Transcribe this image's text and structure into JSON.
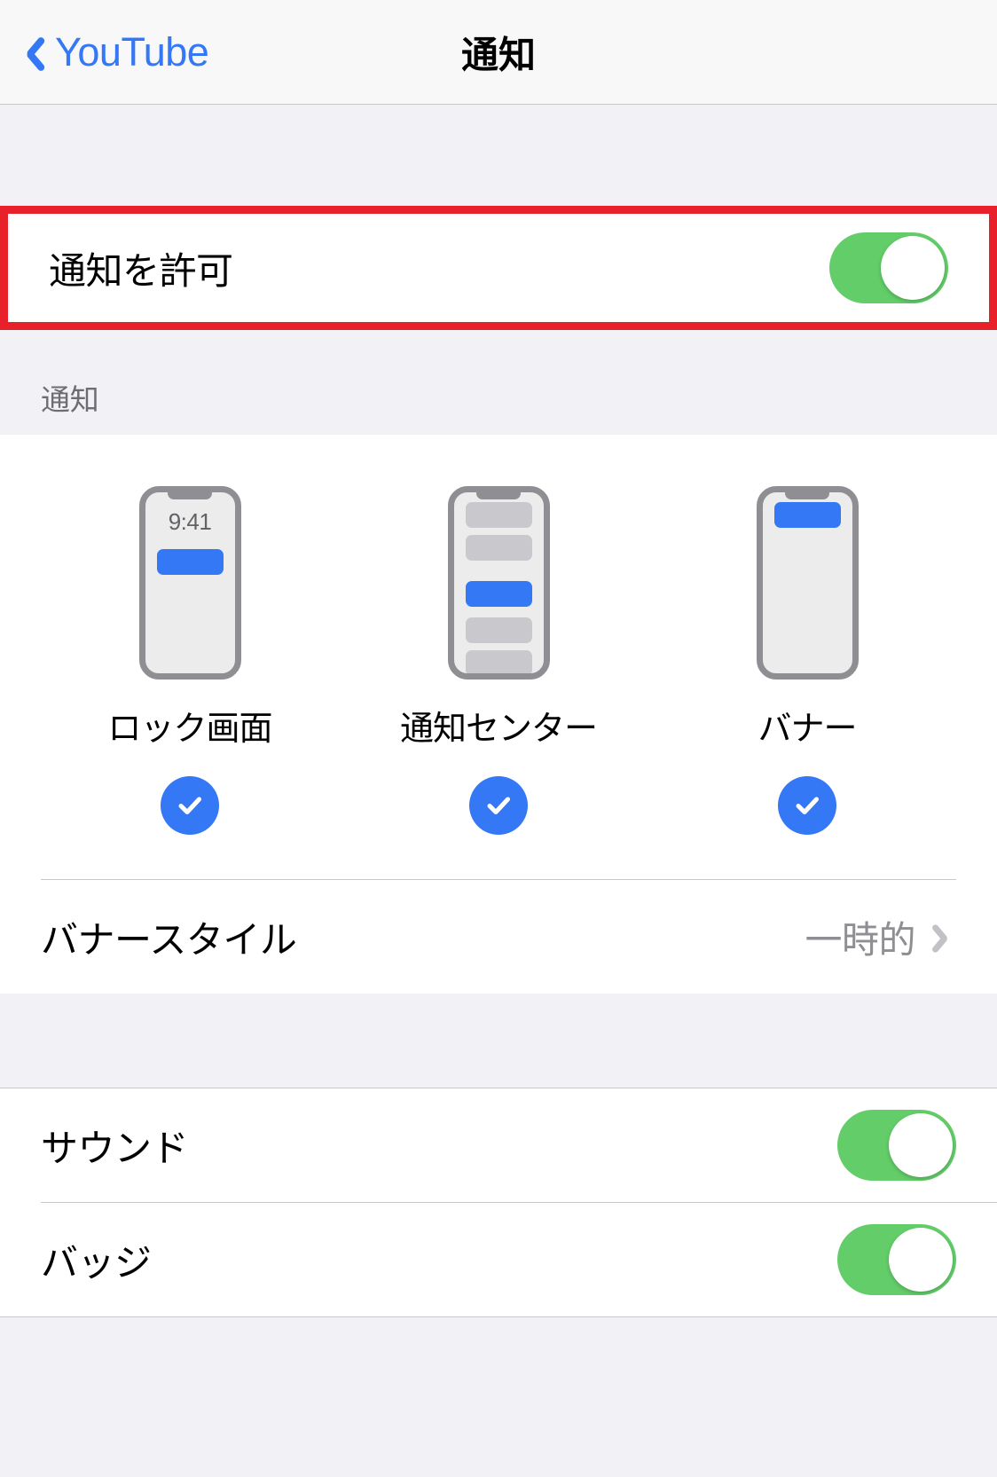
{
  "nav": {
    "back_label": "YouTube",
    "title": "通知"
  },
  "allow_notifications": {
    "label": "通知を許可",
    "toggle_state": "on",
    "highlight_color": "#e8202a"
  },
  "alerts_section": {
    "header": "通知",
    "phones": [
      {
        "label": "ロック画面",
        "time": "9:41",
        "checked": "on",
        "kind": "lock-screen"
      },
      {
        "label": "通知センター",
        "time": "",
        "checked": "on",
        "kind": "notification-center"
      },
      {
        "label": "バナー",
        "time": "",
        "checked": "on",
        "kind": "banner"
      }
    ],
    "banner_style": {
      "label": "バナースタイル",
      "value": "一時的"
    }
  },
  "options_section": {
    "rows": [
      {
        "label": "サウンド",
        "toggle_state": "on"
      },
      {
        "label": "バッジ",
        "toggle_state": "on"
      }
    ]
  },
  "colors": {
    "accent_blue": "#3478f6",
    "toggle_green": "#63ce69",
    "highlight_red": "#e8202a",
    "group_bg": "#f2f1f6"
  }
}
